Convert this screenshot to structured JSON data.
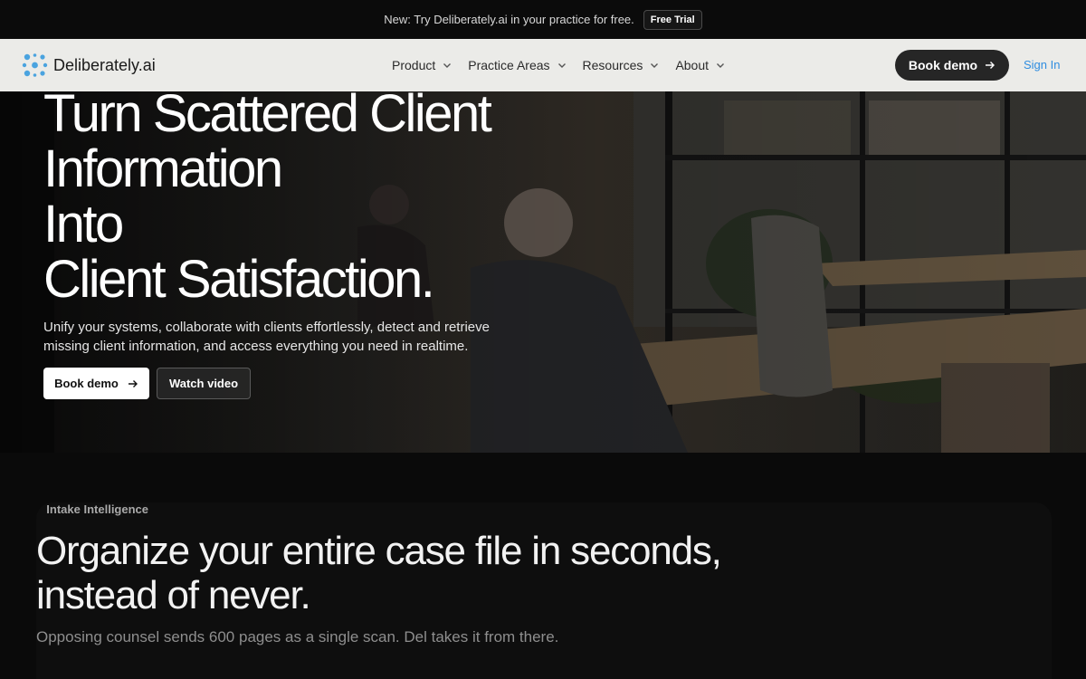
{
  "announcement": {
    "text": "New: Try Deliberately.ai in your practice for free.",
    "button": "Free Trial"
  },
  "nav": {
    "brand": "Deliberately.ai",
    "links": [
      {
        "label": "Product"
      },
      {
        "label": "Practice Areas"
      },
      {
        "label": "Resources"
      },
      {
        "label": "About"
      }
    ],
    "cta": "Book demo",
    "sign_in": "Sign In"
  },
  "hero": {
    "title_lines": [
      "Turn Scattered Client",
      "Information",
      "Into",
      "Client Satisfaction."
    ],
    "subtitle": "Unify your systems, collaborate with clients effortlessly, detect and retrieve missing client information, and access everything you need in realtime.",
    "primary_button": "Book demo",
    "secondary_button": "Watch video"
  },
  "intake": {
    "eyebrow": "Intake Intelligence",
    "title_lines": [
      "Organize your entire case file in seconds,",
      "instead of never."
    ],
    "subtitle": "Opposing counsel sends 600 pages as a single scan. Del takes it from there."
  },
  "colors": {
    "accent_blue": "#2f8de0",
    "logo_blue": "#4aa3df",
    "nav_bg": "#ebebe8",
    "page_bg": "#0a0a0a"
  }
}
